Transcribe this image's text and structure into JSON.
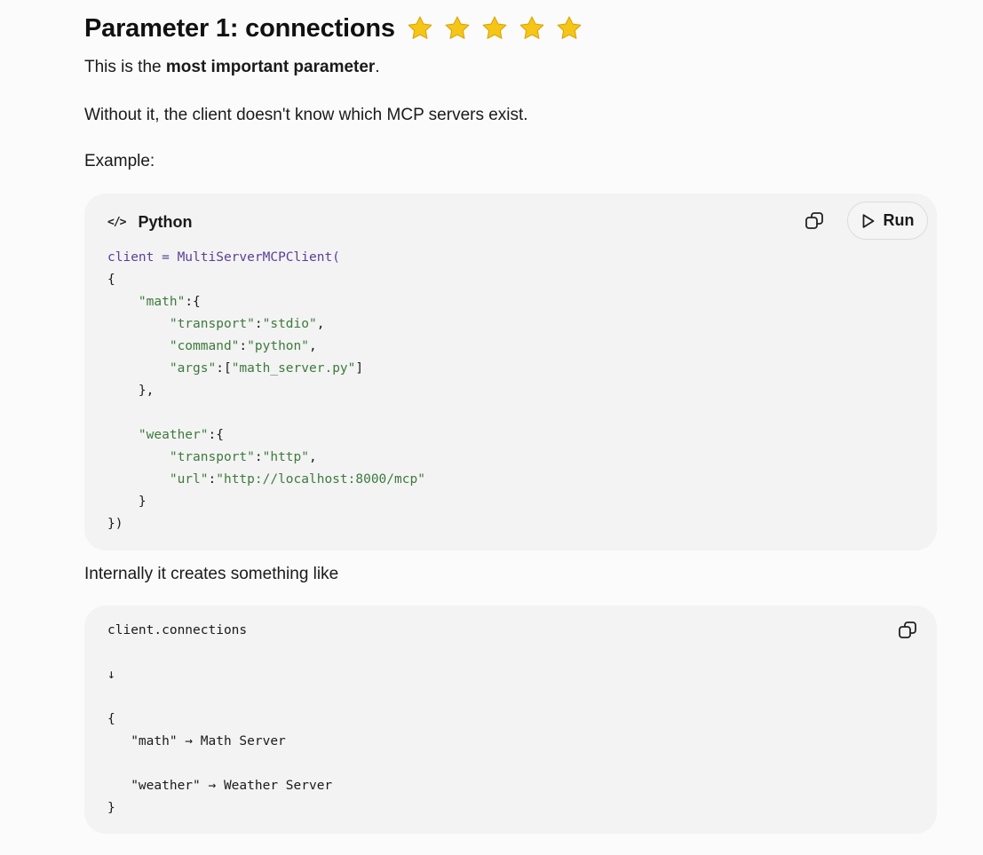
{
  "heading": {
    "title": "Parameter 1: connections",
    "star_count": 5,
    "star_color": "#f5c518"
  },
  "paragraphs": {
    "p1_prefix": "This is the ",
    "p1_bold": "most important parameter",
    "p1_suffix": ".",
    "p2": "Without it, the client doesn't know which MCP servers exist.",
    "p3": "Example:",
    "p4": "Internally it creates something like"
  },
  "code_block_1": {
    "language_icon": "code-icon",
    "language": "Python",
    "copy_icon": "copy-icon",
    "run_icon": "play-icon",
    "run_label": "Run",
    "lines": [
      [
        {
          "t": "client = ",
          "c": "var"
        },
        {
          "t": "MultiServerMCPClient(",
          "c": "var"
        }
      ],
      [
        {
          "t": "{",
          "c": "pun"
        }
      ],
      [
        {
          "t": "    ",
          "c": "pun"
        },
        {
          "t": "\"math\"",
          "c": "str"
        },
        {
          "t": ":{",
          "c": "pun"
        }
      ],
      [
        {
          "t": "        ",
          "c": "pun"
        },
        {
          "t": "\"transport\"",
          "c": "str"
        },
        {
          "t": ":",
          "c": "pun"
        },
        {
          "t": "\"stdio\"",
          "c": "str"
        },
        {
          "t": ",",
          "c": "pun"
        }
      ],
      [
        {
          "t": "        ",
          "c": "pun"
        },
        {
          "t": "\"command\"",
          "c": "str"
        },
        {
          "t": ":",
          "c": "pun"
        },
        {
          "t": "\"python\"",
          "c": "str"
        },
        {
          "t": ",",
          "c": "pun"
        }
      ],
      [
        {
          "t": "        ",
          "c": "pun"
        },
        {
          "t": "\"args\"",
          "c": "str"
        },
        {
          "t": ":[",
          "c": "pun"
        },
        {
          "t": "\"math_server.py\"",
          "c": "str"
        },
        {
          "t": "]",
          "c": "pun"
        }
      ],
      [
        {
          "t": "    },",
          "c": "pun"
        }
      ],
      [
        {
          "t": "",
          "c": "pun"
        }
      ],
      [
        {
          "t": "    ",
          "c": "pun"
        },
        {
          "t": "\"weather\"",
          "c": "str"
        },
        {
          "t": ":{",
          "c": "pun"
        }
      ],
      [
        {
          "t": "        ",
          "c": "pun"
        },
        {
          "t": "\"transport\"",
          "c": "str"
        },
        {
          "t": ":",
          "c": "pun"
        },
        {
          "t": "\"http\"",
          "c": "str"
        },
        {
          "t": ",",
          "c": "pun"
        }
      ],
      [
        {
          "t": "        ",
          "c": "pun"
        },
        {
          "t": "\"url\"",
          "c": "str"
        },
        {
          "t": ":",
          "c": "pun"
        },
        {
          "t": "\"http://localhost:8000/mcp\"",
          "c": "str"
        }
      ],
      [
        {
          "t": "    }",
          "c": "pun"
        }
      ],
      [
        {
          "t": "})",
          "c": "pun"
        }
      ]
    ]
  },
  "code_block_2": {
    "copy_icon": "copy-icon",
    "lines": [
      "client.connections",
      "",
      "↓",
      "",
      "{",
      "   \"math\" → Math Server",
      "",
      "   \"weather\" → Weather Server",
      "}"
    ]
  }
}
